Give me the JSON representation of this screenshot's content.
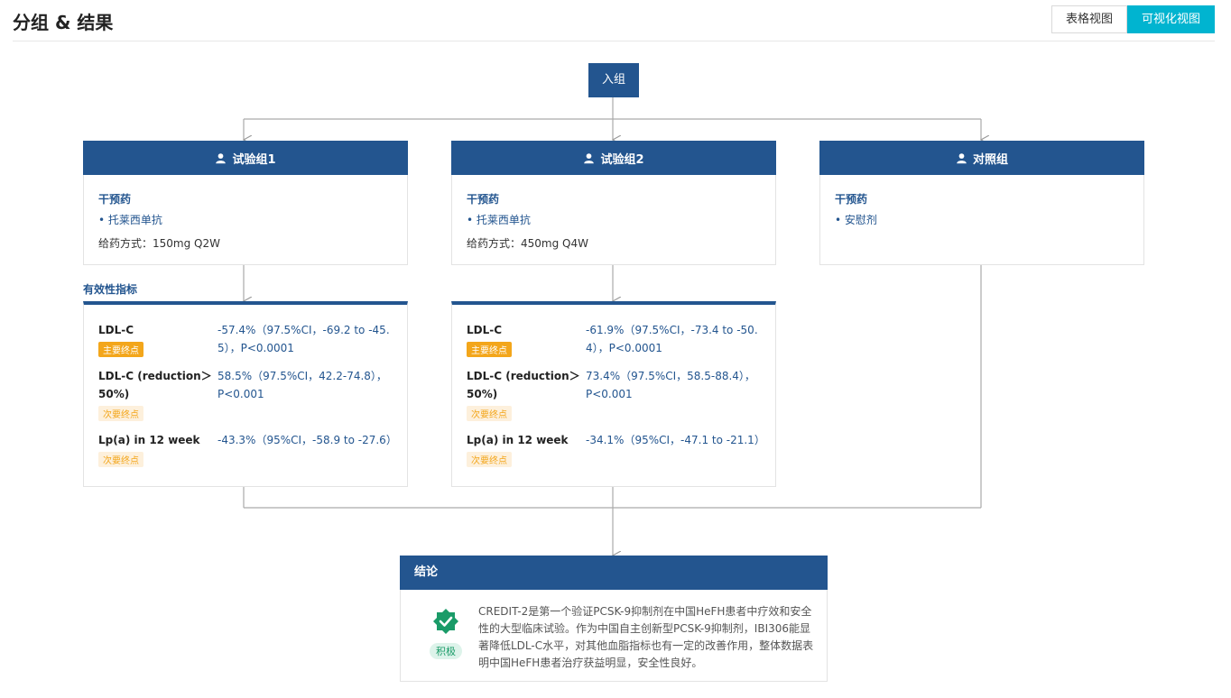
{
  "header": {
    "title": "分组 & 结果",
    "view_table": "表格视图",
    "view_visual": "可视化视图"
  },
  "flow": {
    "enroll_label": "入组"
  },
  "groups": [
    {
      "name": "试验组1",
      "intervention_title": "干预药",
      "drugs": [
        "• 托莱西单抗"
      ],
      "dosing": "给药方式：150mg Q2W"
    },
    {
      "name": "试验组2",
      "intervention_title": "干预药",
      "drugs": [
        "• 托莱西单抗"
      ],
      "dosing": "给药方式：450mg Q4W"
    },
    {
      "name": "对照组",
      "intervention_title": "干预药",
      "drugs": [
        "• 安慰剂"
      ],
      "dosing": ""
    }
  ],
  "efficacy": {
    "label": "有效性指标",
    "cards": [
      {
        "metrics": [
          {
            "name": "LDL-C",
            "value": "-57.4%（97.5%CI，-69.2 to -45.5），P<0.0001",
            "endpoint": "主要终点",
            "type": "primary"
          },
          {
            "name": "LDL-C (reduction＞50%)",
            "value": "58.5%（97.5%CI，42.2-74.8），P<0.001",
            "endpoint": "次要终点",
            "type": "secondary"
          },
          {
            "name": "Lp(a) in 12 week",
            "value": "-43.3%（95%CI，-58.9 to -27.6）",
            "endpoint": "次要终点",
            "type": "secondary"
          }
        ]
      },
      {
        "metrics": [
          {
            "name": "LDL-C",
            "value": "-61.9%（97.5%CI，-73.4 to -50.4），P<0.0001",
            "endpoint": "主要终点",
            "type": "primary"
          },
          {
            "name": "LDL-C (reduction＞50%)",
            "value": "73.4%（97.5%CI，58.5-88.4），P<0.001",
            "endpoint": "次要终点",
            "type": "secondary"
          },
          {
            "name": "Lp(a) in 12 week",
            "value": "-34.1%（95%CI，-47.1 to -21.1）",
            "endpoint": "次要终点",
            "type": "secondary"
          }
        ]
      }
    ]
  },
  "conclusion": {
    "title": "结论",
    "tag": "积极",
    "text": "CREDIT-2是第一个验证PCSK-9抑制剂在中国HeFH患者中疗效和安全性的大型临床试验。作为中国自主创新型PCSK-9抑制剂，IBI306能显著降低LDL-C水平，对其他血脂指标也有一定的改善作用，整体数据表明中国HeFH患者治疗获益明显，安全性良好。"
  },
  "colors": {
    "brand_blue": "#23558f",
    "accent_cyan": "#00b4d0",
    "primary_badge": "#f3a61b",
    "positive_green": "#1a9b68"
  }
}
